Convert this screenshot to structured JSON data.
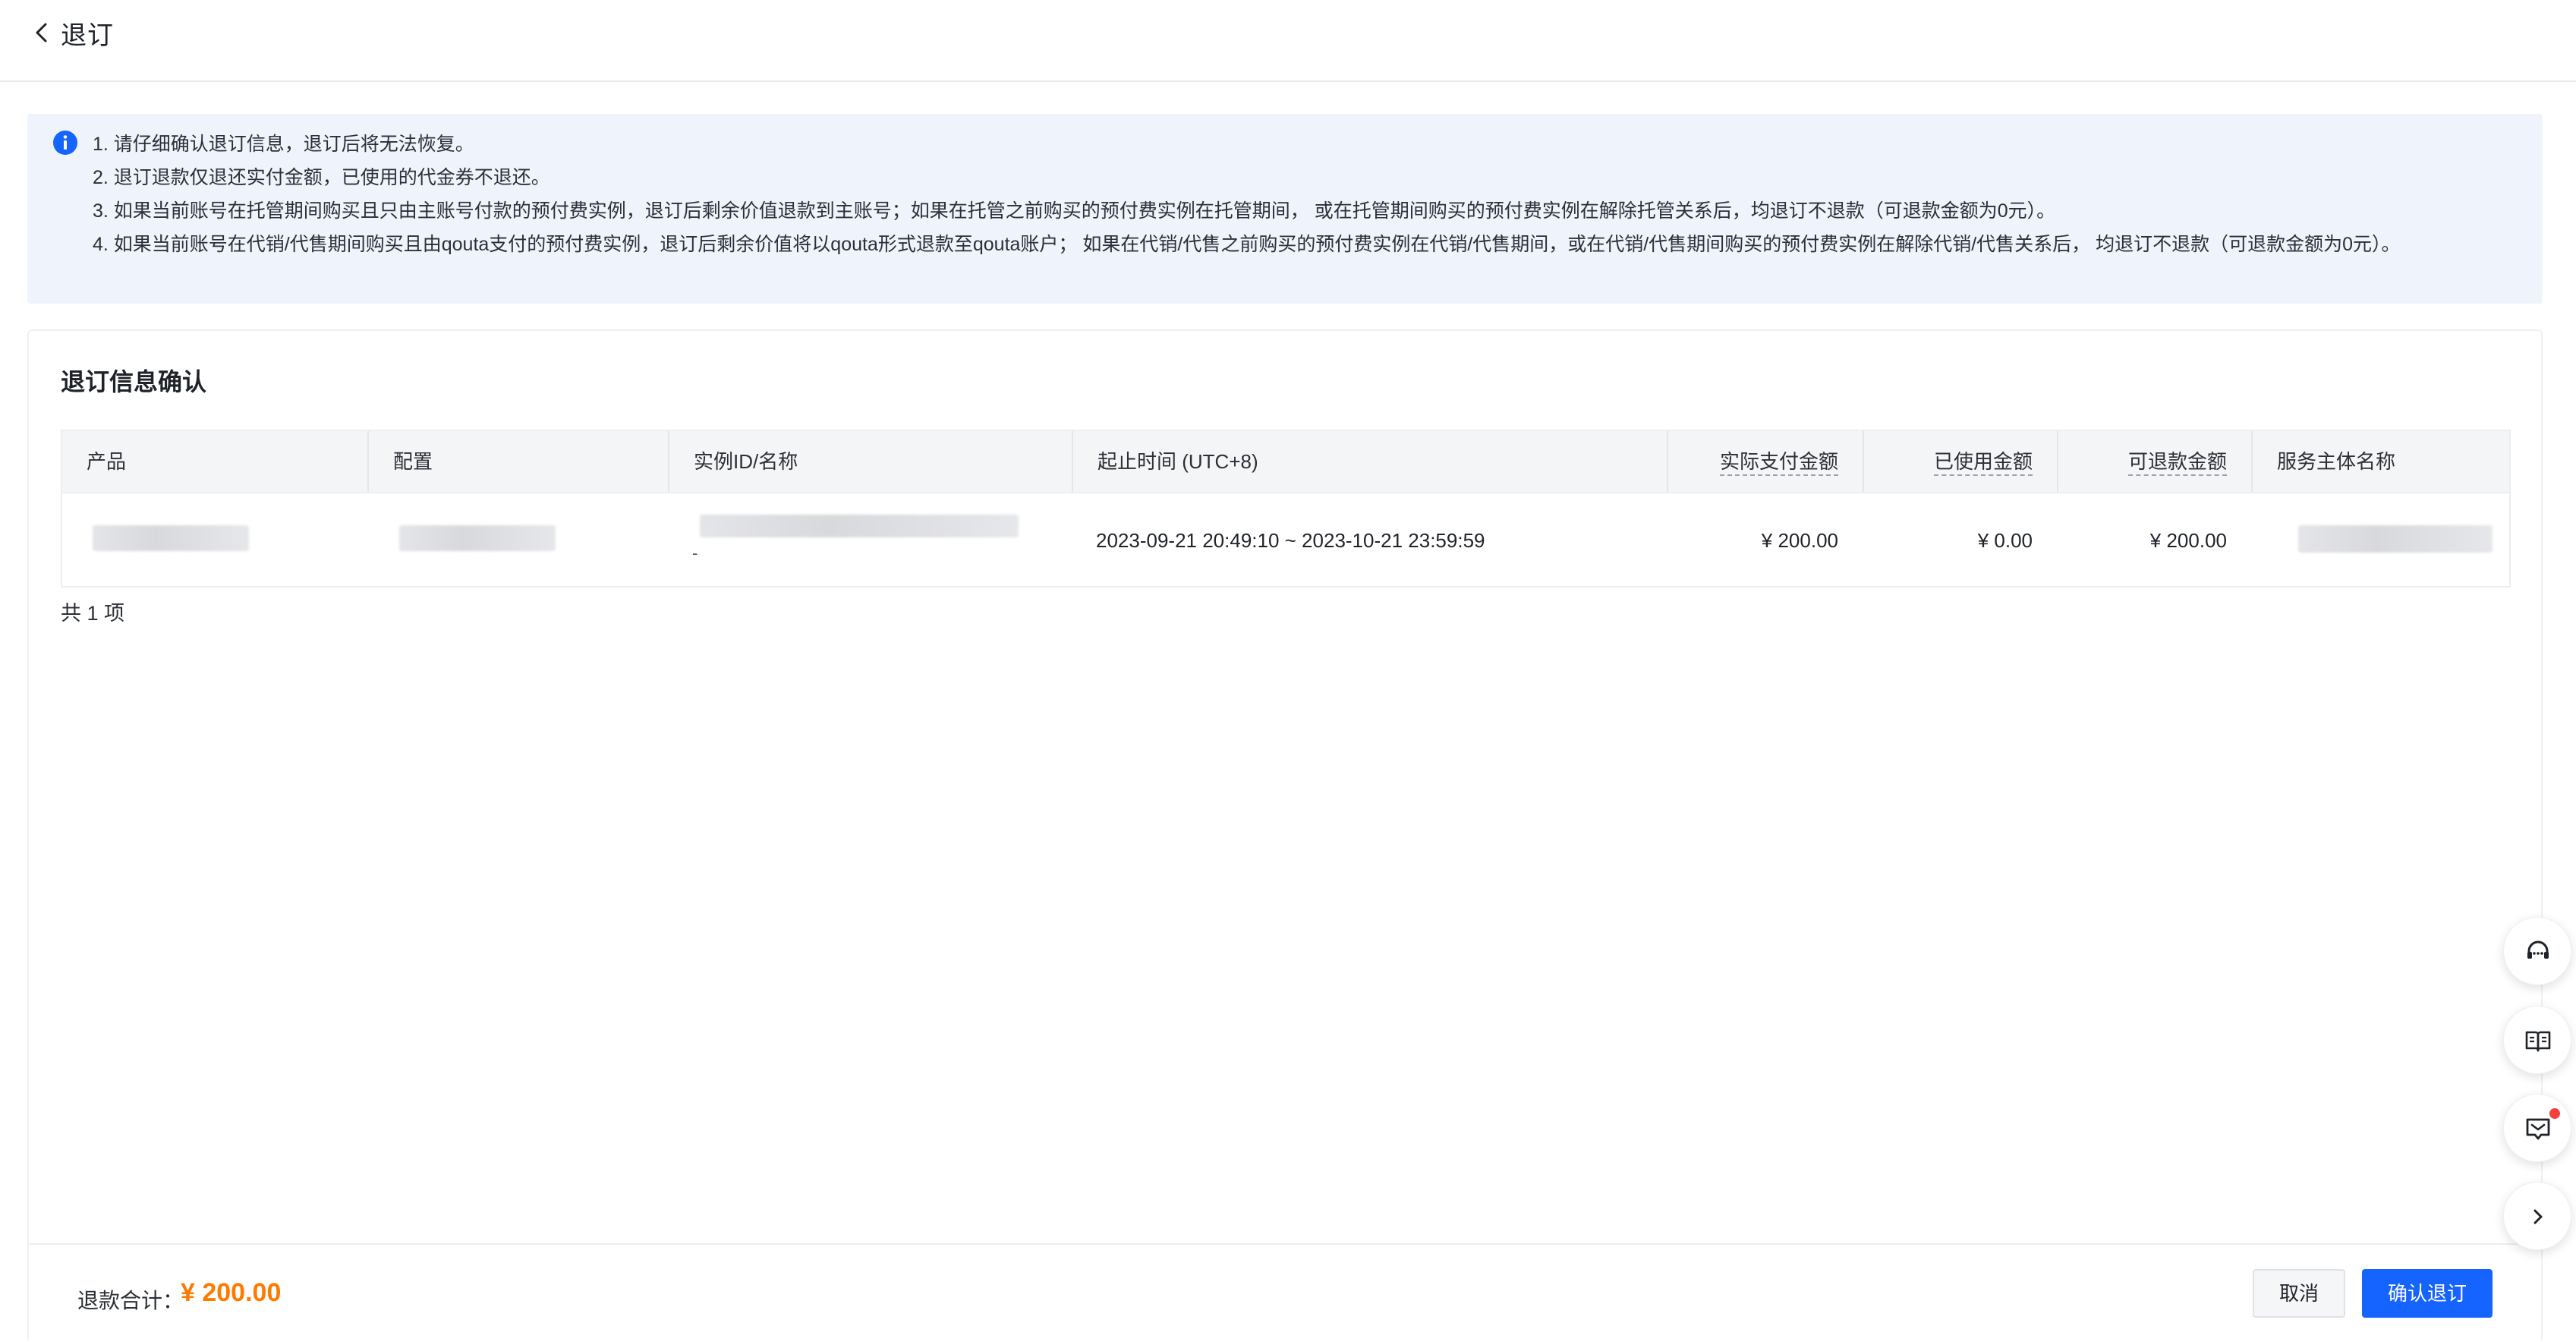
{
  "header": {
    "title": "退订"
  },
  "notice": {
    "lines": [
      "1. 请仔细确认退订信息，退订后将无法恢复。",
      "2. 退订退款仅退还实付金额，已使用的代金券不退还。",
      "3. 如果当前账号在托管期间购买且只由主账号付款的预付费实例，退订后剩余价值退款到主账号；如果在托管之前购买的预付费实例在托管期间， 或在托管期间购买的预付费实例在解除托管关系后，均退订不退款（可退款金额为0元）。",
      "4. 如果当前账号在代销/代售期间购买且由qouta支付的预付费实例，退订后剩余价值将以qouta形式退款至qouta账户； 如果在代销/代售之前购买的预付费实例在代销/代售期间，或在代销/代售期间购买的预付费实例在解除代销/代售关系后， 均退订不退款（可退款金额为0元）。"
    ]
  },
  "section": {
    "title": "退订信息确认"
  },
  "table": {
    "columns": {
      "product": "产品",
      "config": "配置",
      "instance": "实例ID/名称",
      "period": "起止时间 (UTC+8)",
      "paid": "实际支付金额",
      "used": "已使用金额",
      "refundable": "可退款金额",
      "entity": "服务主体名称"
    },
    "rows": [
      {
        "instance_sub": "-",
        "period": "2023-09-21 20:49:10 ~ 2023-10-21 23:59:59",
        "paid": "¥ 200.00",
        "used": "¥ 0.00",
        "refundable": "¥ 200.00"
      }
    ],
    "total": "共 1 项"
  },
  "footer": {
    "refund_label": "退款合计：",
    "refund_amount": "¥ 200.00",
    "cancel_label": "取消",
    "confirm_label": "确认退订"
  },
  "colors": {
    "primary": "#1664ff",
    "amount": "#ff7a00",
    "notice_bg": "#eff4fc",
    "badge": "#f53f3f"
  },
  "icons": [
    "chevron-left-icon",
    "info-icon",
    "headset-icon",
    "book-icon",
    "message-icon",
    "chevron-right-icon"
  ]
}
